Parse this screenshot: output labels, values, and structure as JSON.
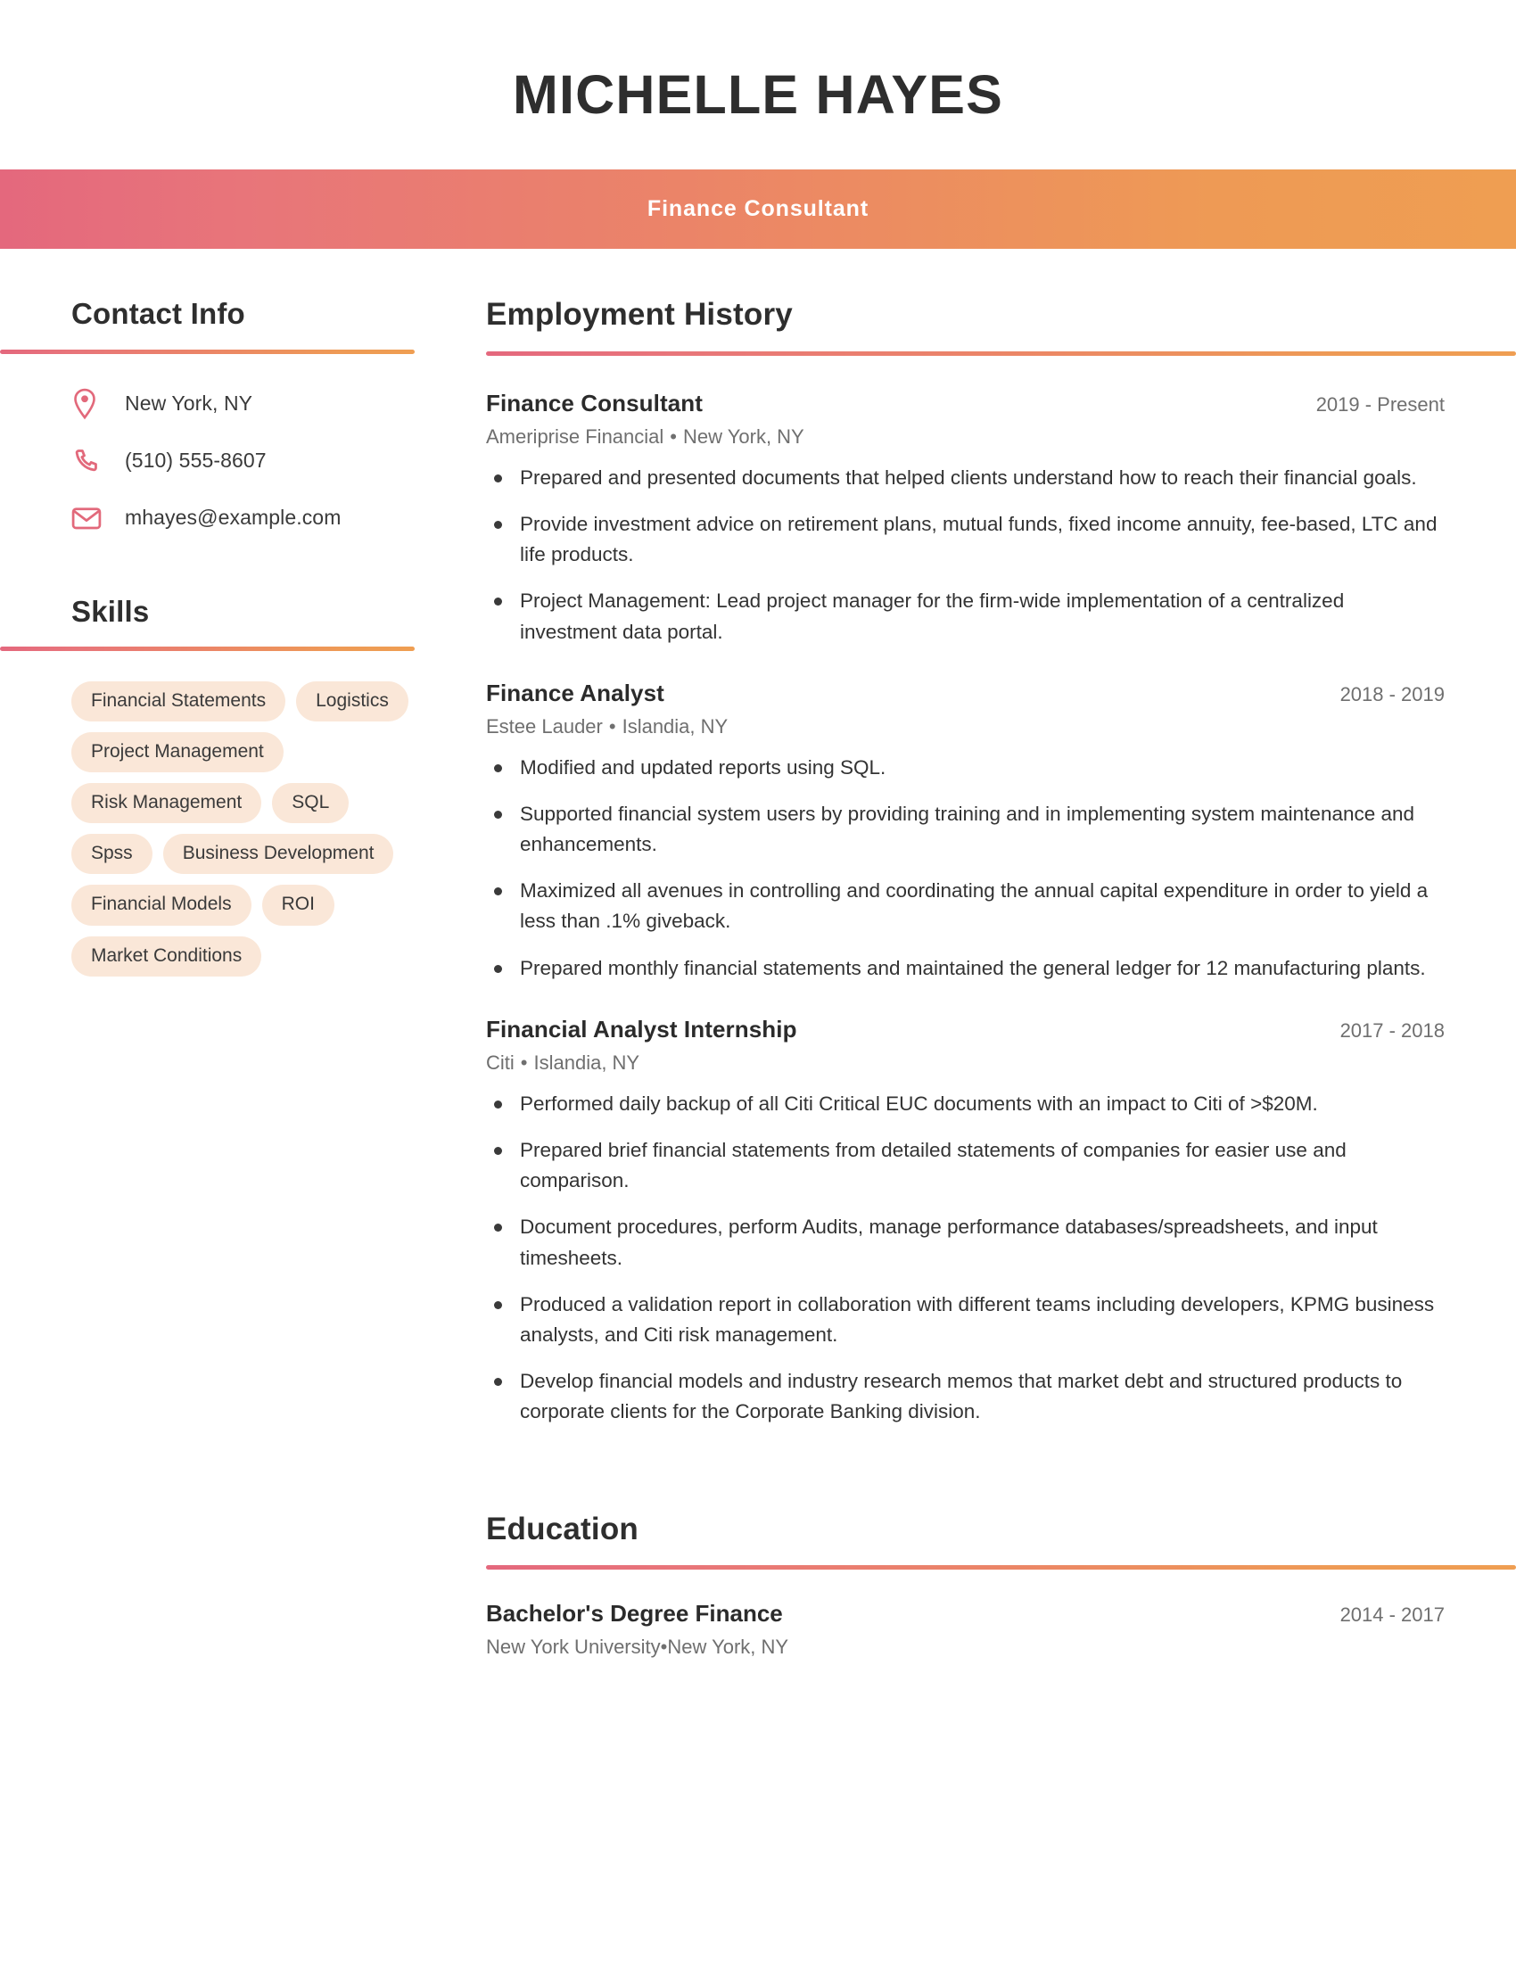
{
  "header": {
    "name": "MICHELLE HAYES",
    "role": "Finance Consultant",
    "gradient_start": "#e4687d",
    "gradient_end": "#ef9e52"
  },
  "sidebar": {
    "contact": {
      "title": "Contact Info",
      "items": [
        {
          "icon": "map-pin-icon",
          "text": "New York, NY"
        },
        {
          "icon": "phone-icon",
          "text": "(510) 555-8607"
        },
        {
          "icon": "envelope-icon",
          "text": "mhayes@example.com"
        }
      ]
    },
    "skills": {
      "title": "Skills",
      "pill_color": "#fae7d8",
      "items": [
        "Financial Statements",
        "Logistics",
        "Project Management",
        "Risk Management",
        "SQL",
        "Spss",
        "Business Development",
        "Financial Models",
        "ROI",
        "Market Conditions"
      ]
    }
  },
  "main": {
    "employment": {
      "title": "Employment History",
      "jobs": [
        {
          "title": "Finance Consultant",
          "dates": "2019 - Present",
          "company": "Ameriprise Financial",
          "location": "New York, NY",
          "bullets": [
            "Prepared and presented documents that helped clients understand how to reach their financial goals.",
            "Provide investment advice on retirement plans, mutual funds, fixed income annuity, fee-based, LTC and life products.",
            "Project Management: Lead project manager for the firm-wide implementation of a centralized investment data portal."
          ]
        },
        {
          "title": "Finance Analyst",
          "dates": "2018 - 2019",
          "company": "Estee Lauder",
          "location": "Islandia, NY",
          "bullets": [
            "Modified and updated reports using SQL.",
            "Supported financial system users by providing training and in implementing system maintenance and enhancements.",
            "Maximized all avenues in controlling and coordinating the annual capital expenditure in order to yield a less than .1% giveback.",
            "Prepared monthly financial statements and maintained the general ledger for 12 manufacturing plants."
          ]
        },
        {
          "title": "Financial Analyst Internship",
          "dates": "2017 - 2018",
          "company": "Citi",
          "location": "Islandia, NY",
          "bullets": [
            "Performed daily backup of all Citi Critical EUC documents with an impact to Citi of >$20M.",
            "Prepared brief financial statements from detailed statements of companies for easier use and comparison.",
            "Document procedures, perform Audits, manage performance databases/spreadsheets, and input timesheets.",
            "Produced a validation report in collaboration with different teams including developers, KPMG business analysts, and Citi risk management.",
            "Develop financial models and industry research memos that market debt and structured products to corporate clients for the Corporate Banking division."
          ]
        }
      ]
    },
    "education": {
      "title": "Education",
      "entries": [
        {
          "degree": "Bachelor's Degree Finance",
          "dates": "2014 - 2017",
          "school": "New York University",
          "location": "New York, NY"
        }
      ]
    }
  },
  "separator": "•"
}
